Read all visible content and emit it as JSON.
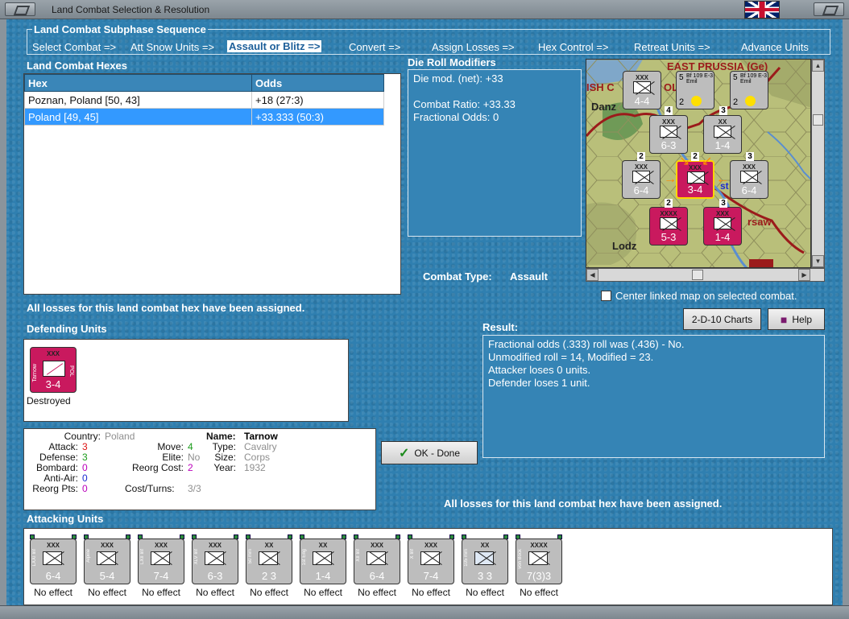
{
  "window": {
    "title": "Land Combat Selection & Resolution"
  },
  "subphase": {
    "legend": "Land Combat Subphase Sequence",
    "steps": [
      "Select Combat =>",
      "Att Snow Units =>",
      "Assault or Blitz =>",
      "Convert =>",
      "Assign Losses =>",
      "Hex Control =>",
      "Retreat Units =>",
      "Advance Units"
    ],
    "active_index": 2
  },
  "hexes": {
    "title": "Land Combat Hexes",
    "columns": [
      "Hex",
      "Odds"
    ],
    "rows": [
      {
        "hex": "Poznan, Poland [50, 43]",
        "odds": "+18 (27:3)"
      },
      {
        "hex": "Poland [49, 45]",
        "odds": "+33.333 (50:3)"
      }
    ],
    "selected_row": 1
  },
  "die_roll": {
    "title": "Die Roll Modifiers",
    "line1": "Die mod. (net): +33",
    "line2": "Combat Ratio: +33.33",
    "line3": "Fractional Odds: 0"
  },
  "combat_type": {
    "label": "Combat Type:",
    "value": "Assault"
  },
  "center_map_label": "Center linked map on selected combat.",
  "losses_msg": "All losses for this land combat hex have been assigned.",
  "buttons": {
    "charts": "2-D-10 Charts",
    "help": "Help",
    "ok": "OK - Done"
  },
  "result": {
    "title": "Result:",
    "lines": [
      "Fractional odds (.333) roll was (.436)  - No.",
      "Unmodified roll = 14, Modified = 23.",
      "Attacker loses 0 units.",
      "Defender loses 1 unit."
    ]
  },
  "defending": {
    "title": "Defending Units",
    "unit": {
      "size": "XXX",
      "name_side": "Tarnow",
      "nation": "POL",
      "stat": "3-4",
      "status": "Destroyed"
    }
  },
  "unit_info": {
    "country_label": "Country:",
    "country": "Poland",
    "attack_label": "Attack:",
    "attack": "3",
    "defense_label": "Defense:",
    "defense": "3",
    "bombard_label": "Bombard:",
    "bombard": "0",
    "antiair_label": "Anti-Air:",
    "antiair": "0",
    "reorg_label": "Reorg Pts:",
    "reorg": "0",
    "move_label": "Move:",
    "move": "4",
    "elite_label": "Elite:",
    "elite": "No",
    "reorg_cost_label": "Reorg Cost:",
    "reorg_cost": "2",
    "cost_label": "Cost/Turns:",
    "cost": "3/3",
    "name_label": "Name:",
    "name": "Tarnow",
    "type_label": "Type:",
    "type": "Cavalry",
    "size_label": "Size:",
    "size": "Corps",
    "year_label": "Year:",
    "year": "1932"
  },
  "attacking": {
    "title": "Attacking Units",
    "units": [
      {
        "size": "XXX",
        "side": "LXXI Inf",
        "stat": "6-4",
        "effect": "No effect"
      },
      {
        "size": "XXX",
        "side": "Alpine",
        "stat": "5-4",
        "effect": "No effect"
      },
      {
        "size": "XXX",
        "side": "LXII Inf",
        "stat": "7-4",
        "effect": "No effect"
      },
      {
        "size": "XXX",
        "side": "XLV Inf",
        "stat": "6-3",
        "effect": "No effect"
      },
      {
        "size": "XX",
        "side": "50 mm",
        "stat": "2 3",
        "effect": "No effect"
      },
      {
        "size": "XX",
        "side": "1st Eng",
        "stat": "1-4",
        "effect": "No effect"
      },
      {
        "size": "XXX",
        "side": "XII Inf",
        "stat": "6-4",
        "effect": "No effect"
      },
      {
        "size": "XXX",
        "side": "X Inf",
        "stat": "7-4",
        "effect": "No effect"
      },
      {
        "size": "XX",
        "side": "105 mm",
        "stat": "3 3",
        "effect": "No effect"
      },
      {
        "size": "XXXX",
        "side": "von Bock",
        "stat": "7(3)3",
        "effect": "No effect"
      }
    ]
  },
  "map": {
    "labels": [
      "EAST PRUSSIA (Ge)",
      "ISH C",
      "Danz",
      "rsaw",
      "Lodz",
      "st",
      "OL"
    ],
    "counters": [
      {
        "size": "XXX",
        "stat": "4-4",
        "color": "grey"
      },
      {
        "size": "",
        "stat": "2",
        "tag": "Bf 109 E-3 Emil",
        "num": "5",
        "color": "grey"
      },
      {
        "size": "",
        "stat": "2",
        "tag": "Bf 109 E-3 Emil",
        "num": "5",
        "color": "grey"
      },
      {
        "size": "XXX",
        "stat": "6-3",
        "color": "grey"
      },
      {
        "size": "XX",
        "stat": "1-4",
        "color": "grey"
      },
      {
        "size": "XXX",
        "stat": "6-4",
        "color": "grey"
      },
      {
        "size": "XXX",
        "stat": "3-4",
        "color": "pink"
      },
      {
        "size": "XXX",
        "stat": "6-4",
        "color": "grey"
      },
      {
        "size": "XXXX",
        "stat": "5-3",
        "color": "pink"
      },
      {
        "size": "XXX",
        "stat": "1-4",
        "color": "pink"
      }
    ],
    "stack_numbers": [
      "4",
      "3",
      "2",
      "2",
      "3",
      "2",
      "3"
    ]
  },
  "colors": {
    "panel": "#3584b5",
    "background": "#2f7fb0",
    "german": "#bdbdbd",
    "polish": "#c9195e",
    "selection": "#3399ff"
  }
}
